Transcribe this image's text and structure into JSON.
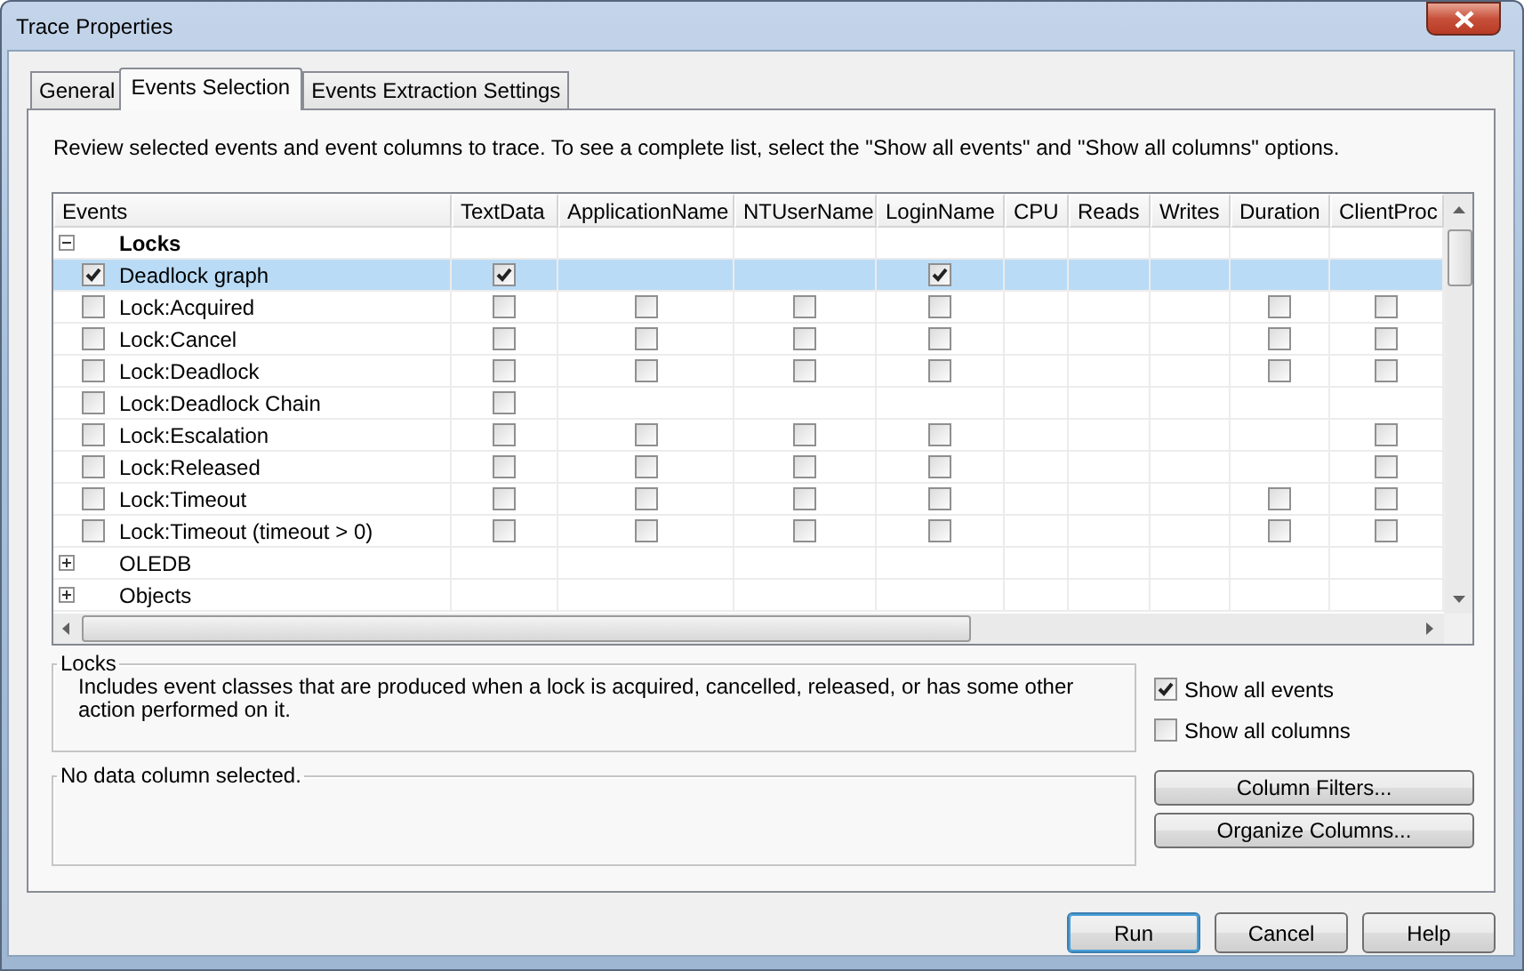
{
  "window": {
    "title": "Trace Properties"
  },
  "tabs": [
    {
      "label": "General",
      "selected": false
    },
    {
      "label": "Events Selection",
      "selected": true
    },
    {
      "label": "Events Extraction Settings",
      "selected": false
    }
  ],
  "instructions": "Review selected events and event columns to trace. To see a complete list, select the \"Show all events\" and \"Show all columns\" options.",
  "grid": {
    "columns": [
      "Events",
      "TextData",
      "ApplicationName",
      "NTUserName",
      "LoginName",
      "CPU",
      "Reads",
      "Writes",
      "Duration",
      "ClientProc"
    ],
    "groups": [
      {
        "name": "Locks",
        "expanded": true,
        "emphasized": true,
        "children": [
          {
            "name": "Deadlock graph",
            "selected": true,
            "checked": true,
            "cells": [
              {
                "kind": "checkbox",
                "checked": true
              },
              {
                "kind": "blank"
              },
              {
                "kind": "blank"
              },
              {
                "kind": "checkbox",
                "checked": true
              },
              {
                "kind": "blank"
              },
              {
                "kind": "blank"
              },
              {
                "kind": "blank"
              },
              {
                "kind": "blank"
              },
              {
                "kind": "blank"
              }
            ]
          },
          {
            "name": "Lock:Acquired",
            "selected": false,
            "checked": false,
            "cells": [
              {
                "kind": "checkbox",
                "checked": false
              },
              {
                "kind": "checkbox",
                "checked": false
              },
              {
                "kind": "checkbox",
                "checked": false
              },
              {
                "kind": "checkbox",
                "checked": false
              },
              {
                "kind": "blank"
              },
              {
                "kind": "blank"
              },
              {
                "kind": "blank"
              },
              {
                "kind": "checkbox",
                "checked": false
              },
              {
                "kind": "checkbox",
                "checked": false
              }
            ]
          },
          {
            "name": "Lock:Cancel",
            "selected": false,
            "checked": false,
            "cells": [
              {
                "kind": "checkbox",
                "checked": false
              },
              {
                "kind": "checkbox",
                "checked": false
              },
              {
                "kind": "checkbox",
                "checked": false
              },
              {
                "kind": "checkbox",
                "checked": false
              },
              {
                "kind": "blank"
              },
              {
                "kind": "blank"
              },
              {
                "kind": "blank"
              },
              {
                "kind": "checkbox",
                "checked": false
              },
              {
                "kind": "checkbox",
                "checked": false
              }
            ]
          },
          {
            "name": "Lock:Deadlock",
            "selected": false,
            "checked": false,
            "cells": [
              {
                "kind": "checkbox",
                "checked": false
              },
              {
                "kind": "checkbox",
                "checked": false
              },
              {
                "kind": "checkbox",
                "checked": false
              },
              {
                "kind": "checkbox",
                "checked": false
              },
              {
                "kind": "blank"
              },
              {
                "kind": "blank"
              },
              {
                "kind": "blank"
              },
              {
                "kind": "checkbox",
                "checked": false
              },
              {
                "kind": "checkbox",
                "checked": false
              }
            ]
          },
          {
            "name": "Lock:Deadlock Chain",
            "selected": false,
            "checked": false,
            "cells": [
              {
                "kind": "checkbox",
                "checked": false
              },
              {
                "kind": "blank"
              },
              {
                "kind": "blank"
              },
              {
                "kind": "blank"
              },
              {
                "kind": "blank"
              },
              {
                "kind": "blank"
              },
              {
                "kind": "blank"
              },
              {
                "kind": "blank"
              },
              {
                "kind": "blank"
              }
            ]
          },
          {
            "name": "Lock:Escalation",
            "selected": false,
            "checked": false,
            "cells": [
              {
                "kind": "checkbox",
                "checked": false
              },
              {
                "kind": "checkbox",
                "checked": false
              },
              {
                "kind": "checkbox",
                "checked": false
              },
              {
                "kind": "checkbox",
                "checked": false
              },
              {
                "kind": "blank"
              },
              {
                "kind": "blank"
              },
              {
                "kind": "blank"
              },
              {
                "kind": "blank"
              },
              {
                "kind": "checkbox",
                "checked": false
              }
            ]
          },
          {
            "name": "Lock:Released",
            "selected": false,
            "checked": false,
            "cells": [
              {
                "kind": "checkbox",
                "checked": false
              },
              {
                "kind": "checkbox",
                "checked": false
              },
              {
                "kind": "checkbox",
                "checked": false
              },
              {
                "kind": "checkbox",
                "checked": false
              },
              {
                "kind": "blank"
              },
              {
                "kind": "blank"
              },
              {
                "kind": "blank"
              },
              {
                "kind": "blank"
              },
              {
                "kind": "checkbox",
                "checked": false
              }
            ]
          },
          {
            "name": "Lock:Timeout",
            "selected": false,
            "checked": false,
            "cells": [
              {
                "kind": "checkbox",
                "checked": false
              },
              {
                "kind": "checkbox",
                "checked": false
              },
              {
                "kind": "checkbox",
                "checked": false
              },
              {
                "kind": "checkbox",
                "checked": false
              },
              {
                "kind": "blank"
              },
              {
                "kind": "blank"
              },
              {
                "kind": "blank"
              },
              {
                "kind": "checkbox",
                "checked": false
              },
              {
                "kind": "checkbox",
                "checked": false
              }
            ]
          },
          {
            "name": "Lock:Timeout (timeout > 0)",
            "selected": false,
            "checked": false,
            "cells": [
              {
                "kind": "checkbox",
                "checked": false
              },
              {
                "kind": "checkbox",
                "checked": false
              },
              {
                "kind": "checkbox",
                "checked": false
              },
              {
                "kind": "checkbox",
                "checked": false
              },
              {
                "kind": "blank"
              },
              {
                "kind": "blank"
              },
              {
                "kind": "blank"
              },
              {
                "kind": "checkbox",
                "checked": false
              },
              {
                "kind": "checkbox",
                "checked": false
              }
            ]
          }
        ]
      },
      {
        "name": "OLEDB",
        "expanded": false,
        "emphasized": false
      },
      {
        "name": "Objects",
        "expanded": false,
        "emphasized": false
      }
    ]
  },
  "description": {
    "title": "Locks",
    "text": "Includes event classes that are produced when a lock is acquired, cancelled, released, or has some other action performed on it."
  },
  "column_info": {
    "title": "No data column selected."
  },
  "options": [
    {
      "label": "Show all events",
      "checked": true
    },
    {
      "label": "Show all columns",
      "checked": false
    }
  ],
  "side_buttons": [
    "Column Filters...",
    "Organize Columns..."
  ],
  "buttons": [
    {
      "label": "Run",
      "default": true
    },
    {
      "label": "Cancel",
      "default": false
    },
    {
      "label": "Help",
      "default": false
    }
  ]
}
